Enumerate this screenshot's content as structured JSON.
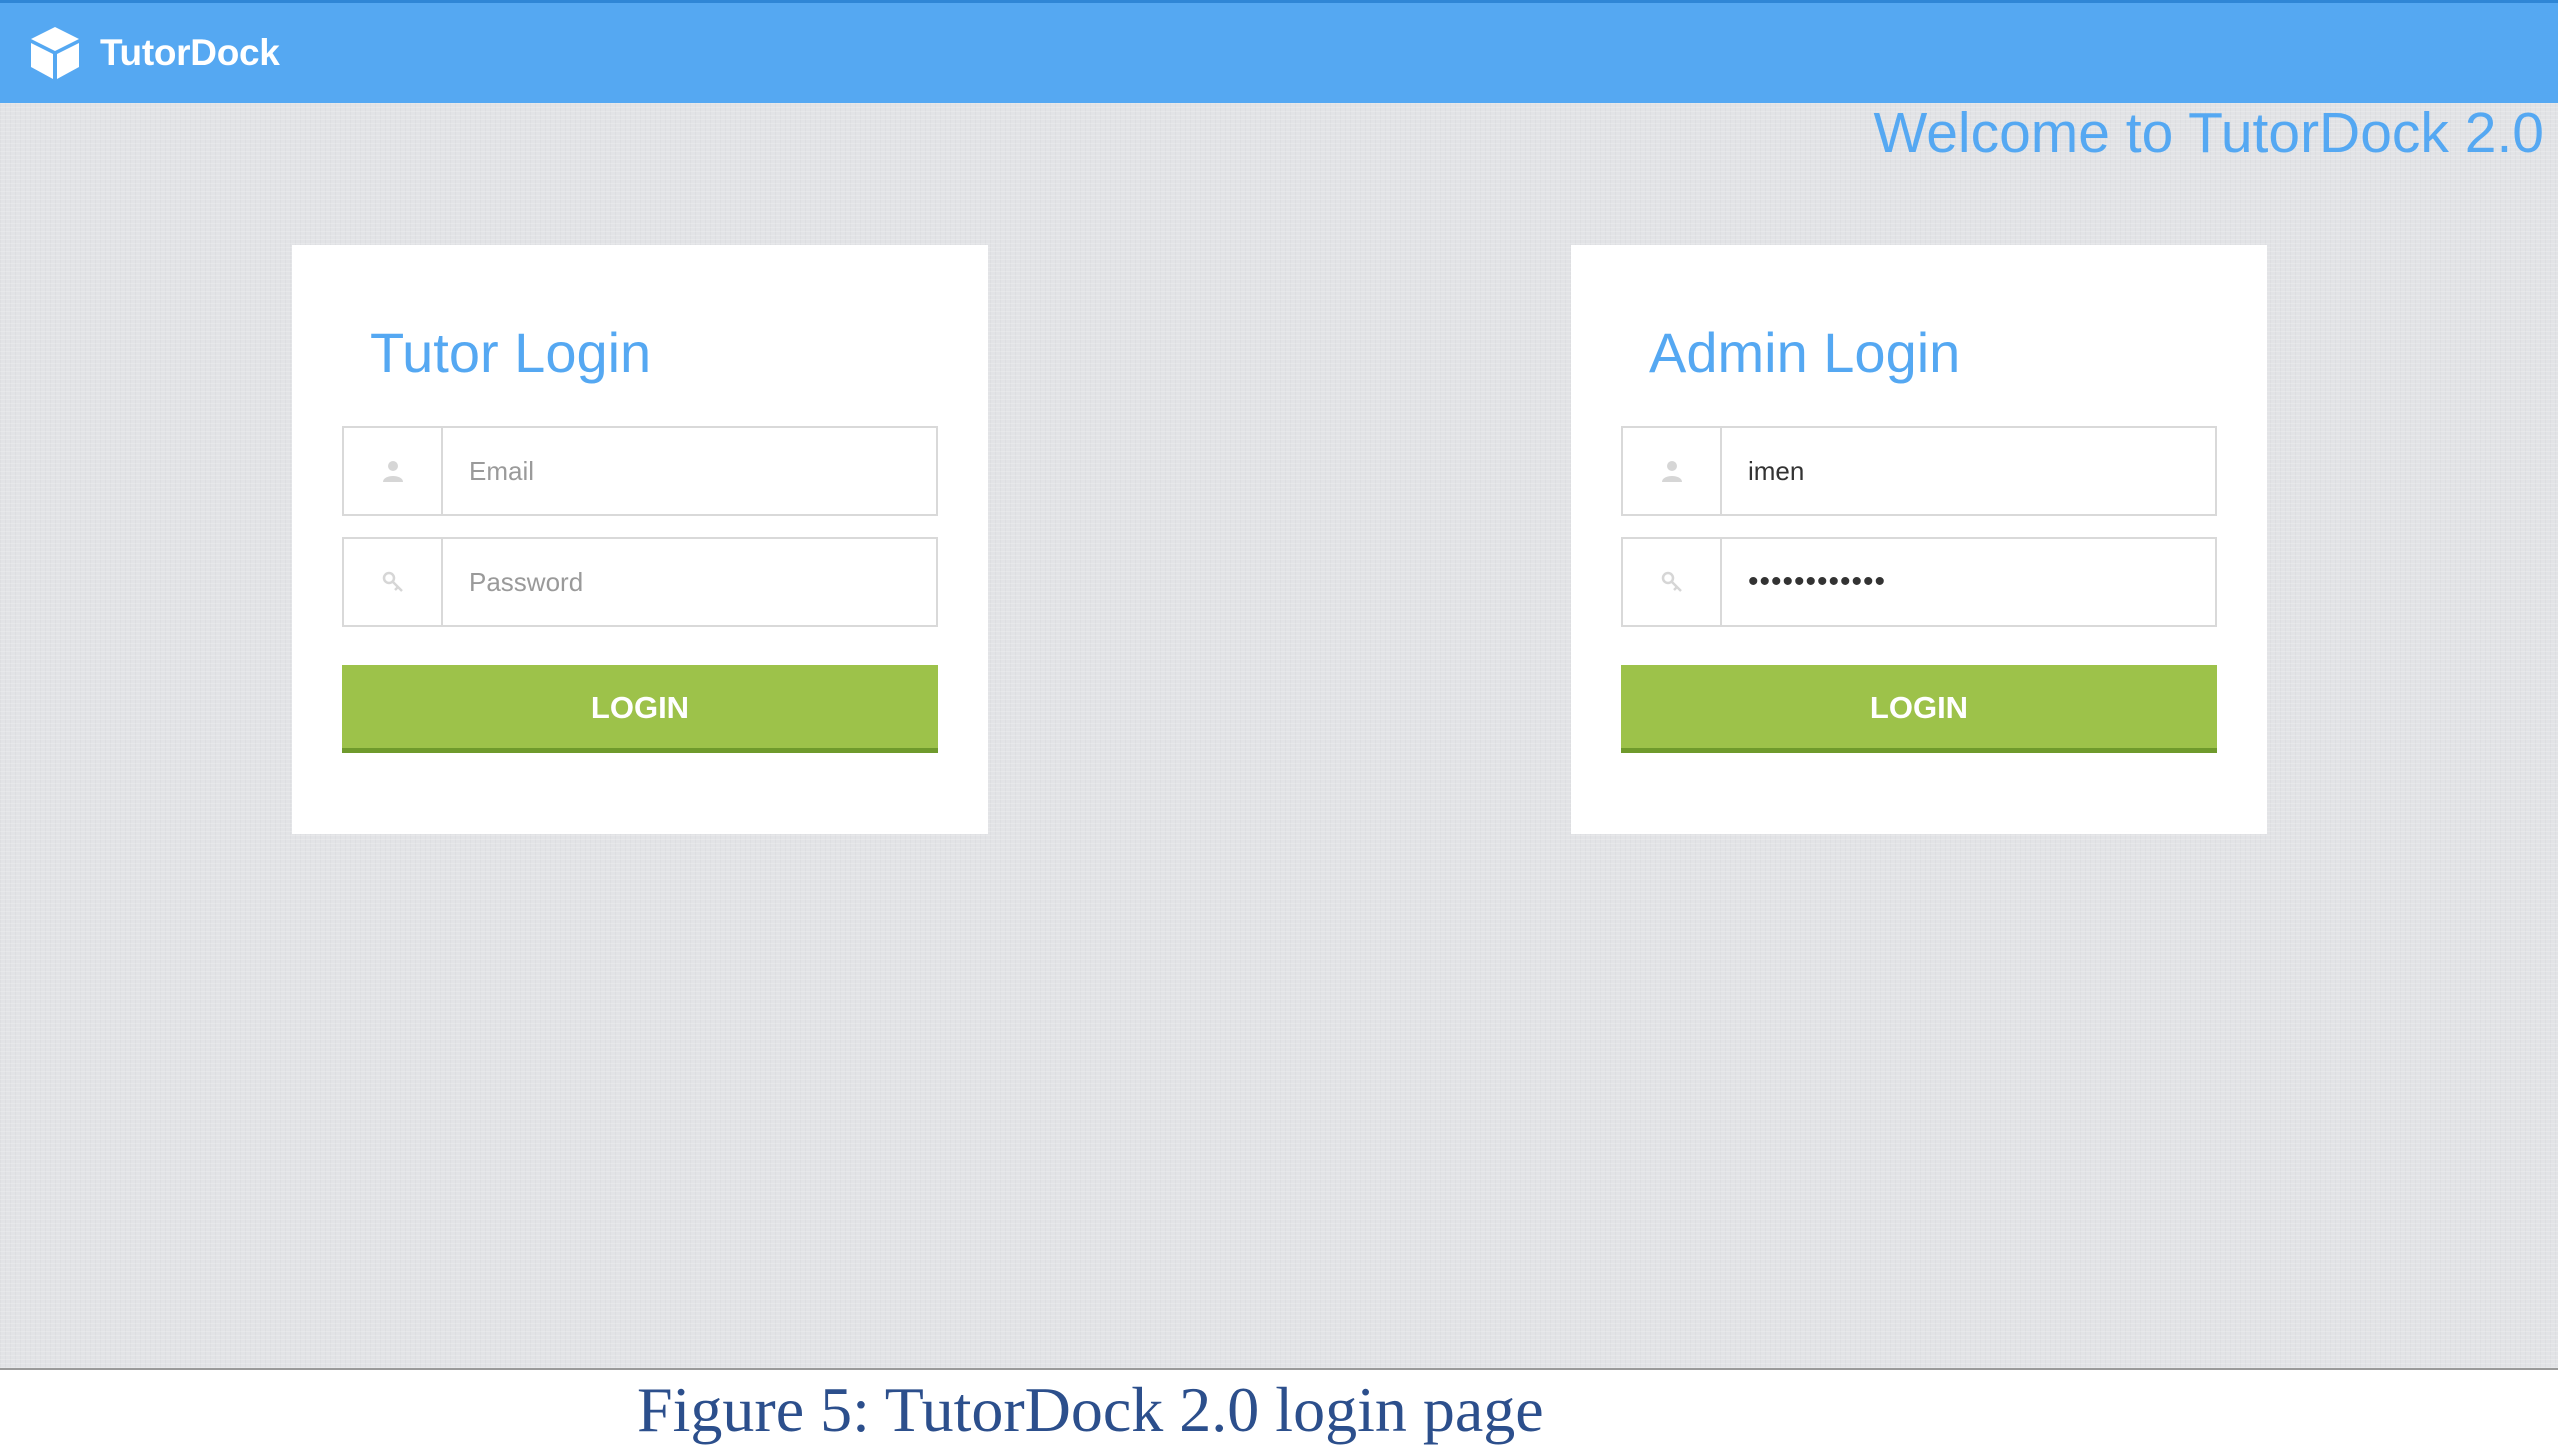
{
  "navbar": {
    "brand_name": "TutorDock",
    "brand_icon": "cube-icon",
    "background_color": "#55a8f2"
  },
  "welcome_text": "Welcome to TutorDock 2.0",
  "tutor_login": {
    "title": "Tutor Login",
    "email": {
      "value": "",
      "placeholder": "Email",
      "icon": "user-icon"
    },
    "password": {
      "value": "",
      "placeholder": "Password",
      "icon": "key-icon"
    },
    "button_label": "LOGIN"
  },
  "admin_login": {
    "title": "Admin Login",
    "username": {
      "value": "imen",
      "icon": "user-icon"
    },
    "password": {
      "value": "imen12345678",
      "icon": "key-icon"
    },
    "button_label": "LOGIN"
  },
  "colors": {
    "accent": "#55a8f2",
    "button": "#9dc24a",
    "page_background": "#e2e3e6"
  },
  "caption": "Figure 5: TutorDock 2.0 login page"
}
